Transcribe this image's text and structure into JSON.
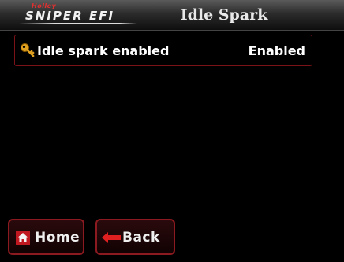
{
  "header": {
    "brand_small": "Holley",
    "brand_logo": "SNIPER EFI",
    "title": "Idle Spark"
  },
  "settings": [
    {
      "icon": "key-icon",
      "label": "Idle spark enabled",
      "value": "Enabled"
    }
  ],
  "nav": {
    "home_label": "Home",
    "back_label": "Back"
  },
  "colors": {
    "accent_border": "#7a1218",
    "key_icon": "#e0a020",
    "arrow_icon": "#e02020"
  }
}
